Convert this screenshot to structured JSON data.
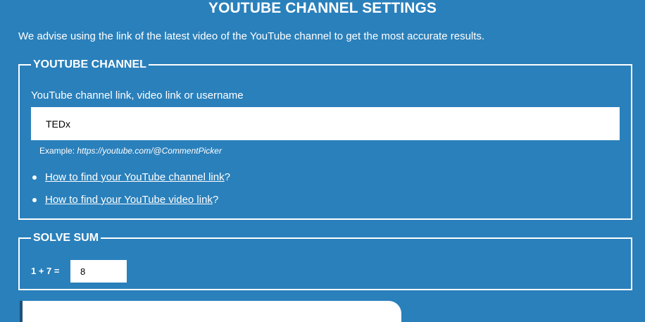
{
  "page": {
    "title": "YOUTUBE CHANNEL SETTINGS",
    "intro": "We advise using the link of the latest video of the YouTube channel to get the most accurate results."
  },
  "channel_section": {
    "legend": "YOUTUBE CHANNEL",
    "field_label": "YouTube channel link, video link or username",
    "input_value": "TEDx",
    "example_prefix": "Example: ",
    "example_url": "https://youtube.com/@CommentPicker",
    "help_links": [
      {
        "label": "How to find your YouTube channel link",
        "suffix": "?"
      },
      {
        "label": "How to find your YouTube video link",
        "suffix": "?"
      }
    ]
  },
  "sum_section": {
    "legend": "SOLVE SUM",
    "equation": "1 + 7 =",
    "answer": "8"
  },
  "colors": {
    "background": "#2a80bb",
    "text": "#ffffff"
  }
}
